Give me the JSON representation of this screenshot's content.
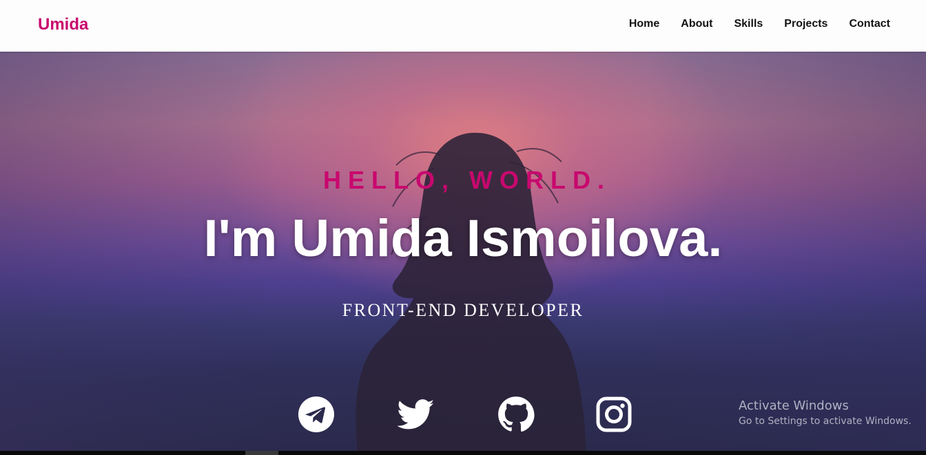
{
  "navbar": {
    "brand": "Umida",
    "links": [
      "Home",
      "About",
      "Skills",
      "Projects",
      "Contact"
    ]
  },
  "hero": {
    "greeting": "HELLO, WORLD.",
    "name": "I'm Umida Ismoilova.",
    "role": "FRONT-END DEVELOPER"
  },
  "social": [
    {
      "icon": "telegram-icon"
    },
    {
      "icon": "twitter-icon"
    },
    {
      "icon": "github-icon"
    },
    {
      "icon": "instagram-icon"
    }
  ],
  "watermark": {
    "title": "Activate Windows",
    "subtitle": "Go to Settings to activate Windows."
  },
  "colors": {
    "accent": "#c8086e",
    "nav_bg": "#fdfdfd",
    "hero_text": "#ffffff"
  }
}
